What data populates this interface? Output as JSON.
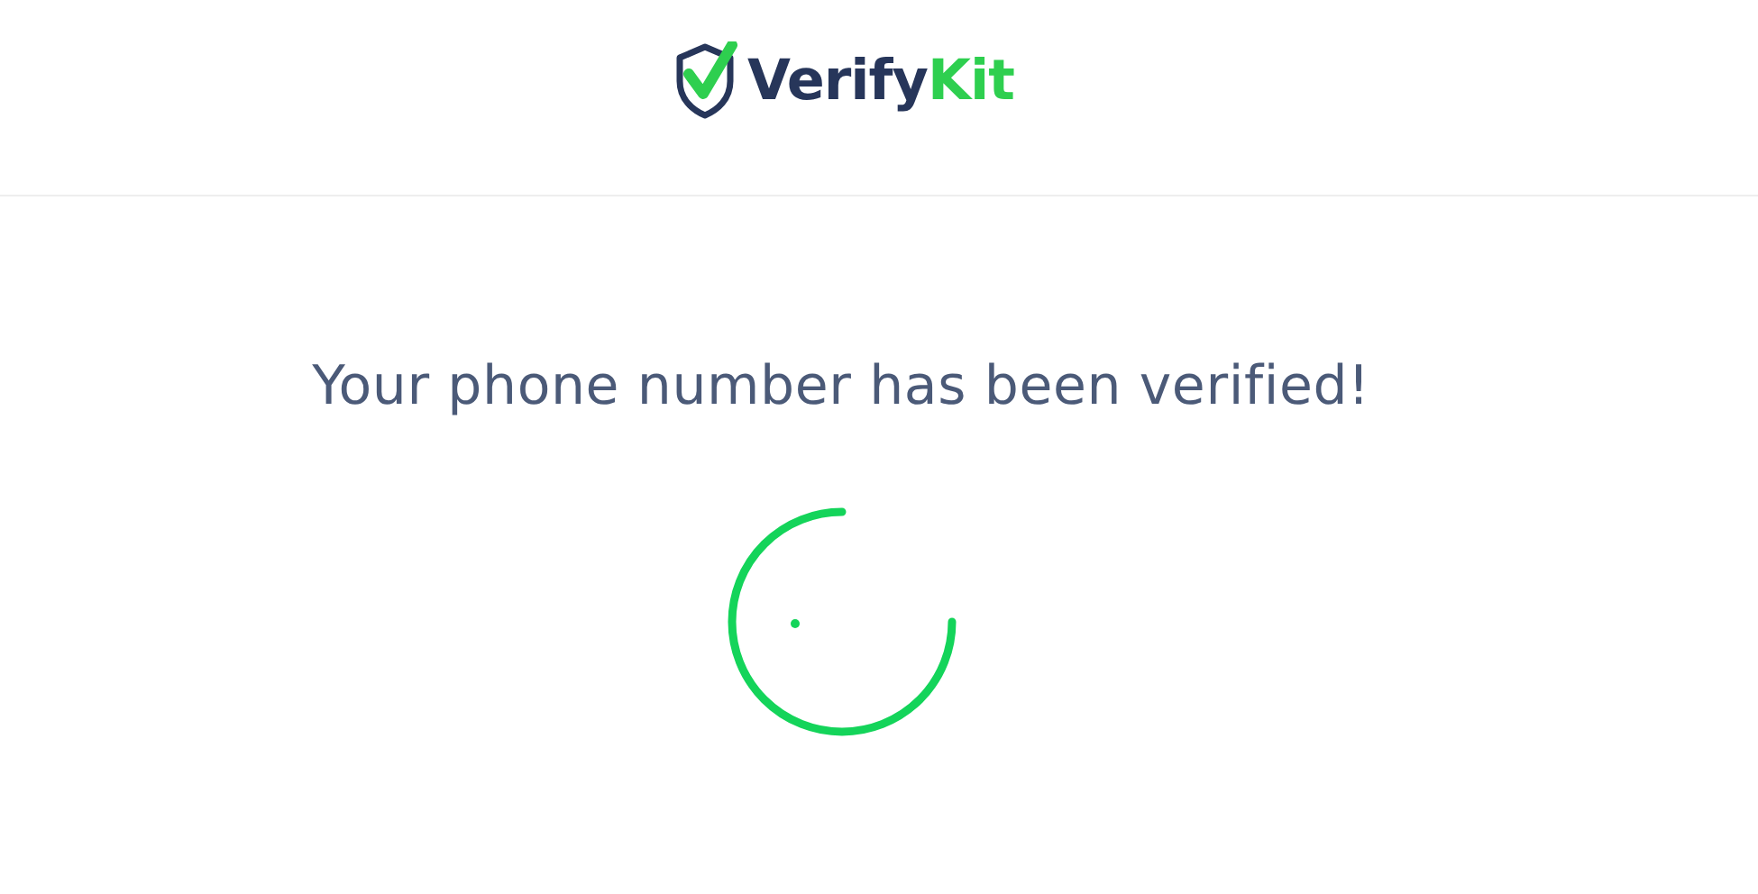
{
  "header": {
    "logo": {
      "name": "Verify",
      "accent": "Kit"
    }
  },
  "message": "Your phone number has been verified!"
}
